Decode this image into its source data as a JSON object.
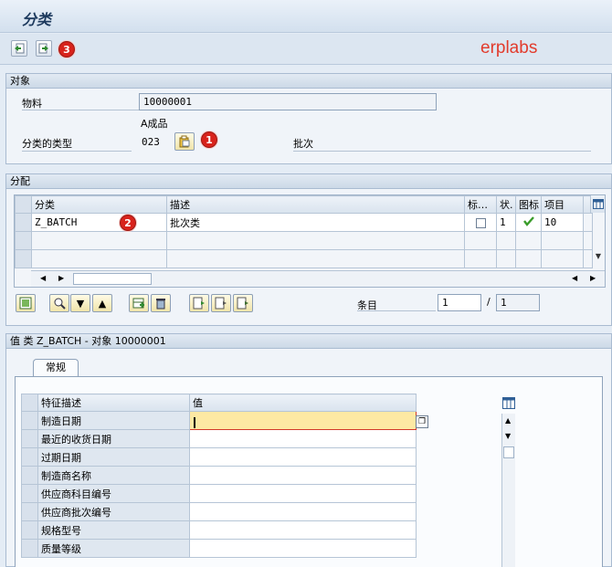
{
  "window": {
    "title": "分类"
  },
  "watermark": "erplabs",
  "badges": {
    "one": "1",
    "two": "2",
    "three": "3"
  },
  "object_section": {
    "header": "对象",
    "material_label": "物料",
    "material_value": "10000001",
    "class_type_label": "分类的类型",
    "class_type_code": "023",
    "class_type_hint": "A成品",
    "class_type_desc": "批次"
  },
  "assign_section": {
    "header": "分配",
    "columns": [
      "分类",
      "描述",
      "标…",
      "状.",
      "图标",
      "项目"
    ],
    "rows": [
      {
        "class": "Z_BATCH",
        "desc": "批次类",
        "std": "",
        "status": "1",
        "item": "10"
      }
    ],
    "entry_label": "条目",
    "entry_current": "1",
    "entry_sep": "/",
    "entry_total": "1"
  },
  "values_section": {
    "header": "值 类 Z_BATCH - 对象 10000001",
    "tab_label": "常规",
    "columns": [
      "特征描述",
      "值"
    ],
    "rows": [
      {
        "name": "制造日期",
        "value": ""
      },
      {
        "name": "最近的收货日期",
        "value": ""
      },
      {
        "name": "过期日期",
        "value": ""
      },
      {
        "name": "制造商名称",
        "value": ""
      },
      {
        "name": "供应商科目编号",
        "value": ""
      },
      {
        "name": "供应商批次编号",
        "value": ""
      },
      {
        "name": "规格型号",
        "value": ""
      },
      {
        "name": "质量等级",
        "value": ""
      }
    ]
  },
  "colors": {
    "badge": "#d8231c",
    "watermark": "#e23b2c",
    "checkmark": "#3a9c2a",
    "active_cell": "#fde9a3"
  }
}
